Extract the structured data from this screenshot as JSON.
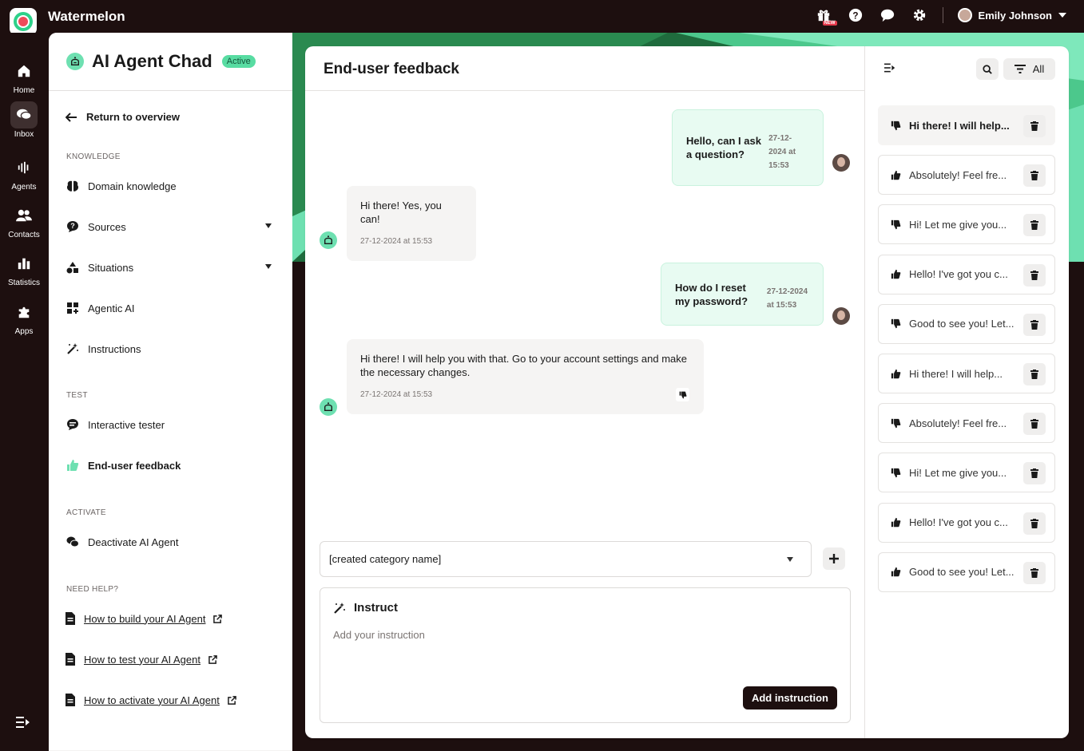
{
  "app": {
    "name": "Watermelon"
  },
  "topbar": {
    "icons": [
      "gift-icon",
      "help-icon",
      "chat-icon",
      "gear-icon"
    ],
    "new_badge": "NEW",
    "user_name": "Emily Johnson"
  },
  "rail": {
    "items": [
      {
        "label": "Home",
        "icon": "home-icon"
      },
      {
        "label": "Inbox",
        "icon": "inbox-icon"
      },
      {
        "label": "Agents",
        "icon": "agents-icon"
      },
      {
        "label": "Contacts",
        "icon": "contacts-icon"
      },
      {
        "label": "Statistics",
        "icon": "statistics-icon"
      },
      {
        "label": "Apps",
        "icon": "apps-icon"
      }
    ]
  },
  "agent": {
    "name": "AI Agent Chad",
    "status": "Active"
  },
  "nav": {
    "return_label": "Return to overview",
    "sections": {
      "knowledge": "KNOWLEDGE",
      "test": "TEST",
      "activate": "ACTIVATE",
      "help": "NEED HELP?"
    },
    "items": {
      "domain_knowledge": "Domain knowledge",
      "sources": "Sources",
      "situations": "Situations",
      "agentic_ai": "Agentic AI",
      "instructions": "Instructions",
      "interactive_tester": "Interactive tester",
      "end_user_feedback": "End-user feedback",
      "deactivate": "Deactivate AI Agent"
    },
    "help_links": [
      "How to build your AI Agent",
      "How to test your AI Agent",
      "How to activate your AI Agent"
    ]
  },
  "main": {
    "title": "End-user feedback",
    "messages": [
      {
        "from": "user",
        "text": "Hello, can I ask a question?",
        "time": "27-12-2024 at 15:53"
      },
      {
        "from": "bot",
        "text": "Hi there! Yes, you can!",
        "time": "27-12-2024 at 15:53"
      },
      {
        "from": "user",
        "text": "How do I reset my password?",
        "time": "27-12-2024 at 15:53"
      },
      {
        "from": "bot",
        "text": "Hi there! I will help you with that. Go to your account settings and make the necessary changes.",
        "time": "27-12-2024 at 15:53",
        "rating": "thumbs-down"
      }
    ],
    "category_select": {
      "value": "[created category name]"
    },
    "instruct": {
      "title": "Instruct",
      "placeholder": "Add your instruction",
      "button": "Add instruction"
    }
  },
  "feedback_list": {
    "filter_label": "All",
    "items": [
      {
        "text": "Hi there! I will help...",
        "rating": "thumbs-down",
        "selected": true
      },
      {
        "text": "Absolutely! Feel fre...",
        "rating": "thumbs-up"
      },
      {
        "text": "Hi! Let me give you...",
        "rating": "thumbs-down"
      },
      {
        "text": "Hello! I've got you c...",
        "rating": "thumbs-up"
      },
      {
        "text": "Good to see you! Let...",
        "rating": "thumbs-down"
      },
      {
        "text": "Hi there! I will help...",
        "rating": "thumbs-up"
      },
      {
        "text": "Absolutely! Feel fre...",
        "rating": "thumbs-down"
      },
      {
        "text": "Hi! Let me give you...",
        "rating": "thumbs-down"
      },
      {
        "text": "Hello! I've got you c...",
        "rating": "thumbs-up"
      },
      {
        "text": "Good to see you! Let...",
        "rating": "thumbs-up"
      }
    ]
  },
  "colors": {
    "dark": "#1d0f0f",
    "mint": "#6ee0b1",
    "green_accent": "#2e9a5a",
    "user_bubble": "#e8fbf2"
  }
}
